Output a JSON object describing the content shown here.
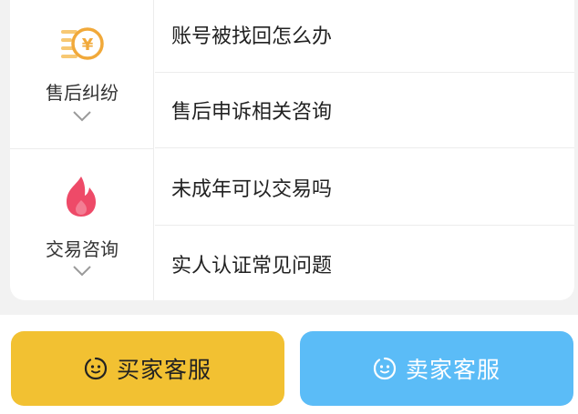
{
  "categories": [
    {
      "label": "售后纠纷",
      "icon": "coin-stack-icon",
      "questions": [
        "账号被找回怎么办",
        "售后申诉相关咨询"
      ]
    },
    {
      "label": "交易咨询",
      "icon": "flame-icon",
      "questions": [
        "未成年可以交易吗",
        "实人认证常见问题"
      ]
    }
  ],
  "footer": {
    "buyer_service": "买家客服",
    "seller_service": "卖家客服"
  },
  "colors": {
    "buyer_button": "#f2c132",
    "seller_button": "#5bbcf7",
    "coin_icon": "#f1a93a",
    "flame_icon": "#ee4a68"
  }
}
